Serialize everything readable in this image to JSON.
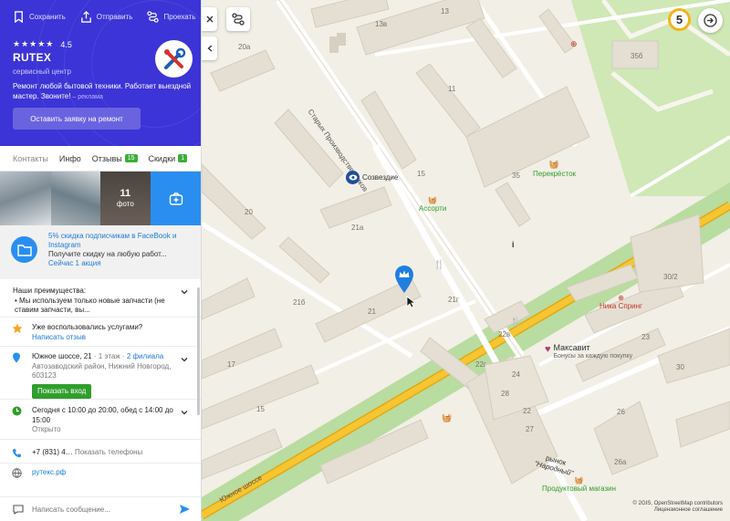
{
  "sidebar": {
    "actions": {
      "save": "Сохранить",
      "share": "Отправить",
      "route": "Проехать"
    },
    "rating": {
      "stars": "★★★★★",
      "value": "4.5"
    },
    "company_name": "RUTEX",
    "category": "сервисный центр",
    "ad": {
      "text": "Ремонт любой бытовой техники. Работает выездной мастер. Звоните!",
      "mark": " – реклама"
    },
    "cta_label": "Оставить заявку на ремонт",
    "tabs": [
      {
        "label": "Контакты",
        "count": ""
      },
      {
        "label": "Инфо",
        "count": ""
      },
      {
        "label": "Отзывы",
        "count": "15"
      },
      {
        "label": "Скидки",
        "count": "1"
      }
    ],
    "photos": {
      "count": "11",
      "label": "фото"
    },
    "promo": {
      "title": "5% скидка подписчикам в FaceBook и Instagram",
      "desc": "Получите скидку на любую работ...",
      "link": "Сейчас 1 акция"
    },
    "advantages": {
      "title": "Наши преимущества:",
      "text": "• Мы используем только новые запчасти (не ставим запчасти, вы..."
    },
    "review": {
      "question": "Уже воспользовались услугами?",
      "link": "Написать отзыв"
    },
    "address": {
      "street": "Южное шоссе, 21",
      "floor": " · 1 этаж · ",
      "branches": "2 филиала",
      "district": "Автозаводский район, Нижний Новгород, 603123",
      "entrance_button": "Показать вход"
    },
    "hours": {
      "text": "Сегодня с 10:00 до 20:00, обед с 14:00 до 15:00",
      "status": "Открыто"
    },
    "phone": {
      "number": "+7 (831) 4…",
      "show": "Показать телефоны"
    },
    "site": "рутекс.рф",
    "message_placeholder": "Написать сообщение..."
  },
  "map": {
    "layers_count": "5",
    "street_labels": {
      "starye_proizvodstvennikov": "Старых Производственников",
      "yuzhnoe_shosse": "Южное шоссе"
    },
    "poi": {
      "sozvezdie": "Созвездие",
      "assorti": "Ассорти",
      "perekrestok": "Перекрёсток",
      "nika_spring": "Ника Спринг",
      "maksavit": "Максавит",
      "maksavit_sub": "Бонусы за каждую покупку",
      "market": "рынок",
      "market_name": "\"Народный\"",
      "produkty": "Продуктовый магазин"
    },
    "house_numbers": [
      "13в",
      "20а",
      "13",
      "20",
      "21а",
      "21б",
      "21",
      "21г",
      "22",
      "22г",
      "22в",
      "17",
      "15",
      "15",
      "11",
      "26а",
      "26",
      "24",
      "28",
      "30/2",
      "30",
      "23",
      "35",
      "35б",
      "27"
    ],
    "copyright_1": "© 2GIS, OpenStreetMap contributors",
    "copyright_2": "Лицензионное соглашение"
  },
  "colors": {
    "brand": "#3c34d6",
    "accent_blue": "#2a8ef0",
    "green": "#2f9e2c",
    "road_main": "#f2b41b"
  }
}
